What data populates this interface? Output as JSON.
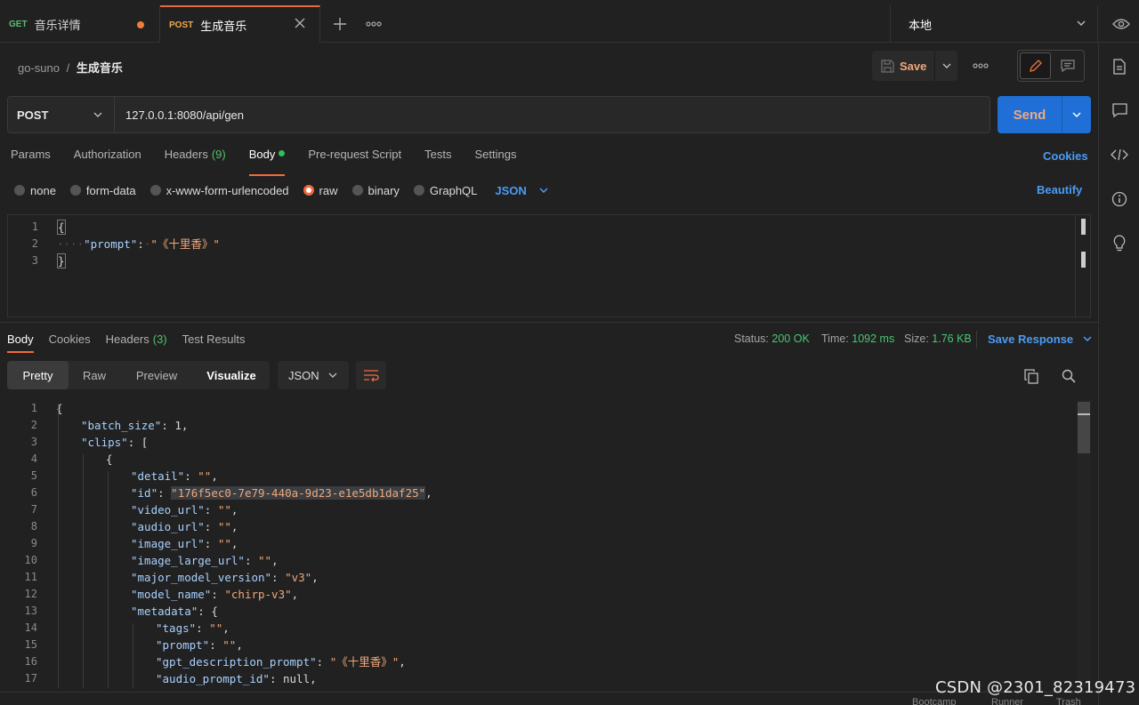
{
  "tabs": [
    {
      "method": "GET",
      "name": "音乐详情",
      "unsaved": true
    },
    {
      "method": "POST",
      "name": "生成音乐",
      "active": true
    }
  ],
  "environment": "本地",
  "breadcrumb": {
    "collection": "go-suno",
    "separator": "/",
    "request": "生成音乐"
  },
  "toolbar": {
    "save_label": "Save"
  },
  "request": {
    "method": "POST",
    "url": "127.0.0.1:8080/api/gen",
    "send_label": "Send",
    "tabs": {
      "params": "Params",
      "authorization": "Authorization",
      "headers": "Headers",
      "headers_count": "(9)",
      "body": "Body",
      "pre_request": "Pre-request Script",
      "tests": "Tests",
      "settings": "Settings"
    },
    "cookies_label": "Cookies",
    "body_types": {
      "none": "none",
      "form_data": "form-data",
      "urlencoded": "x-www-form-urlencoded",
      "raw": "raw",
      "binary": "binary",
      "graphql": "GraphQL"
    },
    "body_format": "JSON",
    "beautify_label": "Beautify",
    "body_lines": [
      {
        "num": "1",
        "text": "{"
      },
      {
        "num": "2",
        "key": "\"prompt\"",
        "value": "\"《十里香》\""
      },
      {
        "num": "3",
        "text": "}"
      }
    ]
  },
  "response": {
    "tabs": {
      "body": "Body",
      "cookies": "Cookies",
      "headers": "Headers",
      "headers_count": "(3)",
      "test_results": "Test Results"
    },
    "status_label": "Status:",
    "status_value": "200 OK",
    "time_label": "Time:",
    "time_value": "1092 ms",
    "size_label": "Size:",
    "size_value": "1.76 KB",
    "save_response_label": "Save Response",
    "views": {
      "pretty": "Pretty",
      "raw": "Raw",
      "preview": "Preview",
      "visualize": "Visualize"
    },
    "format": "JSON",
    "lines": [
      {
        "num": "1",
        "indent": 0,
        "text": "{"
      },
      {
        "num": "2",
        "indent": 1,
        "key": "\"batch_size\"",
        "num_value": "1",
        "tail": ","
      },
      {
        "num": "3",
        "indent": 1,
        "key": "\"clips\"",
        "punct": "["
      },
      {
        "num": "4",
        "indent": 2,
        "text": "{"
      },
      {
        "num": "5",
        "indent": 3,
        "key": "\"detail\"",
        "value": "\"\"",
        "tail": ","
      },
      {
        "num": "6",
        "indent": 3,
        "key": "\"id\"",
        "value": "\"176f5ec0-7e79-440a-9d23-e1e5db1daf25\"",
        "tail": ","
      },
      {
        "num": "7",
        "indent": 3,
        "key": "\"video_url\"",
        "value": "\"\"",
        "tail": ","
      },
      {
        "num": "8",
        "indent": 3,
        "key": "\"audio_url\"",
        "value": "\"\"",
        "tail": ","
      },
      {
        "num": "9",
        "indent": 3,
        "key": "\"image_url\"",
        "value": "\"\"",
        "tail": ","
      },
      {
        "num": "10",
        "indent": 3,
        "key": "\"image_large_url\"",
        "value": "\"\"",
        "tail": ","
      },
      {
        "num": "11",
        "indent": 3,
        "key": "\"major_model_version\"",
        "value": "\"v3\"",
        "tail": ","
      },
      {
        "num": "12",
        "indent": 3,
        "key": "\"model_name\"",
        "value": "\"chirp-v3\"",
        "tail": ","
      },
      {
        "num": "13",
        "indent": 3,
        "key": "\"metadata\"",
        "punct": "{"
      },
      {
        "num": "14",
        "indent": 4,
        "key": "\"tags\"",
        "value": "\"\"",
        "tail": ","
      },
      {
        "num": "15",
        "indent": 4,
        "key": "\"prompt\"",
        "value": "\"\"",
        "tail": ","
      },
      {
        "num": "16",
        "indent": 4,
        "key": "\"gpt_description_prompt\"",
        "value": "\"《十里香》\"",
        "tail": ","
      },
      {
        "num": "17",
        "indent": 4,
        "key": "\"audio_prompt_id\"",
        "num_value": "null",
        "tail": ","
      }
    ]
  },
  "footer": {
    "bootcamp": "Bootcamp",
    "runner": "Runner",
    "trash": "Trash"
  },
  "watermark": "CSDN @2301_82319473",
  "colors": {
    "accent": "#f26b3a",
    "send": "#1f6fd6",
    "link": "#4a9cf5",
    "status_ok": "#48c774"
  }
}
